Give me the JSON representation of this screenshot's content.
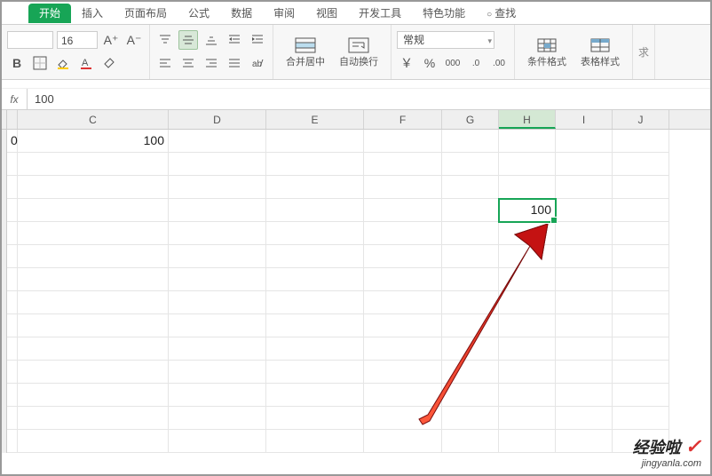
{
  "tabs": {
    "start": "开始",
    "insert": "插入",
    "layout": "页面布局",
    "formula": "公式",
    "data": "数据",
    "review": "审阅",
    "view": "视图",
    "dev": "开发工具",
    "special": "特色功能",
    "find": "查找"
  },
  "font": {
    "size": "16",
    "increase_glyph": "A⁺",
    "decrease_glyph": "A⁻"
  },
  "align": {
    "merge_center": "合并居中",
    "wrap": "自动换行"
  },
  "numfmt": {
    "selected": "常规",
    "currency": "￥",
    "percent": "%",
    "thousands": "000",
    "inc_dec": ".0",
    "dec_inc": ".00"
  },
  "styles": {
    "cond_fmt": "条件格式",
    "table_style": "表格样式"
  },
  "more_glyph": "求",
  "fx": {
    "label": "fx",
    "value": "100"
  },
  "columns": [
    "C",
    "D",
    "E",
    "F",
    "G",
    "H",
    "I",
    "J"
  ],
  "colWidths": {
    "stub": 6,
    "partialB": 12,
    "C": 170,
    "D": 110,
    "E": 110,
    "F": 88,
    "G": 64,
    "H": 64,
    "I": 64,
    "J": 64
  },
  "cells": {
    "b1": "0",
    "c1": "100",
    "h4": "100"
  },
  "selectedCol": "H",
  "watermark": {
    "line1": "经验啦",
    "check": "✓",
    "line2": "jingyanla.com"
  }
}
